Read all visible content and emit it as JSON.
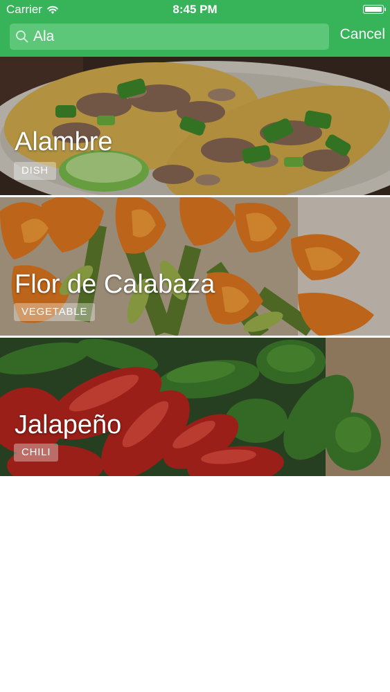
{
  "status_bar": {
    "carrier": "Carrier",
    "time": "8:45 PM"
  },
  "search": {
    "query": "Ala",
    "cancel_label": "Cancel"
  },
  "results": [
    {
      "title": "Alambre",
      "category": "DISH"
    },
    {
      "title": "Flor de Calabaza",
      "category": "VEGETABLE"
    },
    {
      "title": "Jalapeño",
      "category": "CHILI"
    }
  ],
  "colors": {
    "header_green": "#37b45a",
    "search_field_green": "#5cc779"
  }
}
